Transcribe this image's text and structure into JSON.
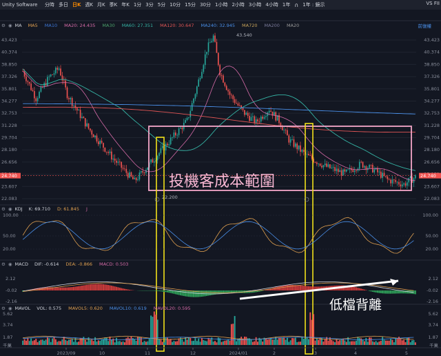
{
  "topbar": {
    "symbol": "Unity Software",
    "timeframes": [
      "分時",
      "多日",
      "日K",
      "週K",
      "月K",
      "季K",
      "年K",
      "1分",
      "3分",
      "5分",
      "10分",
      "15分",
      "30分",
      "1小時",
      "2小時",
      "3小時",
      "4小時",
      "1年"
    ],
    "active_timeframe": "日K",
    "extra": "1年 : 鏡示",
    "right_label": "VS FII"
  },
  "price_header": {
    "indicator": "MA",
    "items": [
      {
        "label": "MA5",
        "color": "#e0a050"
      },
      {
        "label": "MA10",
        "color": "#3d77d6"
      },
      {
        "label": "MA20: 24.435",
        "color": "#d66ba8"
      },
      {
        "label": "MA30",
        "color": "#4aa06a"
      },
      {
        "label": "MA60: 27.351",
        "color": "#35b3a4"
      },
      {
        "label": "MA120: 30.647",
        "color": "#e05555"
      },
      {
        "label": "MA240: 32.945",
        "color": "#4a8fe8"
      },
      {
        "label": "MA720",
        "color": "#c7a35a"
      },
      {
        "label": "MA200",
        "color": "#7a7a9a"
      },
      {
        "label": "MA20",
        "color": "#9a9a9a"
      }
    ],
    "right_label": "前復權"
  },
  "price_axis": [
    "43.423",
    "40.374",
    "38.850",
    "37.326",
    "35.801",
    "34.277",
    "32.753",
    "31.228",
    "29.704",
    "28.180",
    "26.656",
    "25.131",
    "23.607",
    "22.083"
  ],
  "current_price": "24.740",
  "high_label": "43.540",
  "low_label": "22.200",
  "annotation_box_text": "投機客成本範圍",
  "kdj_header": {
    "indicator": "KDJ",
    "items": [
      {
        "label": "K: 69.710",
        "color": "#d1d4dc"
      },
      {
        "label": "D: 61.845",
        "color": "#e0a050"
      },
      {
        "label": "J",
        "color": "#d66ba8"
      }
    ],
    "axis": [
      "100.00",
      "50.00",
      "20.00"
    ]
  },
  "macd_header": {
    "indicator": "MACD",
    "items": [
      {
        "label": "DIF: -0.614",
        "color": "#d1d4dc"
      },
      {
        "label": "DEA: -0.866",
        "color": "#e0a050"
      },
      {
        "label": "MACD: 0.503",
        "color": "#d66ba8"
      }
    ],
    "axis": [
      "2.12",
      "-0.02",
      "-2.16"
    ]
  },
  "macd_annotation": "低檔背離",
  "vol_header": {
    "indicator": "MAVOL",
    "items": [
      {
        "label": "VOL: 0.575",
        "color": "#d1d4dc"
      },
      {
        "label": "MAVOL5: 0.620",
        "color": "#e0a050"
      },
      {
        "label": "MAVOL10: 0.619",
        "color": "#4a8fe8"
      },
      {
        "label": "MAVOL20: 0.595",
        "color": "#d66ba8"
      }
    ],
    "axis": [
      "5.62",
      "3.74",
      "1.87",
      "千萬"
    ]
  },
  "x_axis": [
    "2023/09",
    "10",
    "11",
    "12",
    "2024/01",
    "2",
    "3",
    "4",
    "5"
  ]
}
